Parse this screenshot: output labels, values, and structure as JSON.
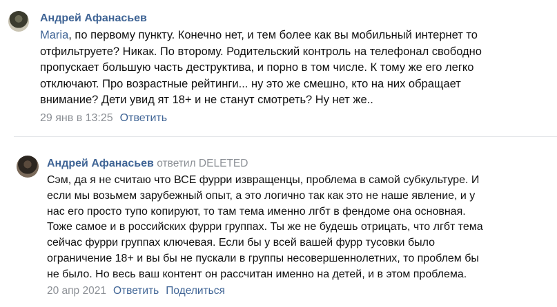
{
  "comments": [
    {
      "author": "Андрей Афанасьев",
      "mention": "Maria",
      "lines": [
        ", по первому пункту. Конечно нет, и тем более как вы мобильный интернет то",
        "отфильтруете? Никак. По второму. Родительский контроль на телефонал свободно",
        "пропускает большую часть деструктива, и порно в том числе. К тому же его легко",
        "отключают. Про возрастные рейтинги... ну это же смешно, кто на них обращает",
        "внимание? Дети увид ят 18+ и не станут смотреть? Ну нет же.."
      ],
      "date": "29 янв в 13:25",
      "reply_label": "Ответить"
    },
    {
      "author": "Андрей Афанасьев",
      "reply_to": "ответил DELETED",
      "lines": [
        "Сэм, да я не считаю что ВСЕ фурри извращенцы, проблема в самой субкультуре. И",
        "если мы возьмем зарубежный опыт, а это логично так как это не наше явление, и у",
        "нас его просто тупо копируют, то там тема именно лгбт в фендоме она основная.",
        "Тоже самое и в российских фурри группах. Ты же не будешь отрицать, что лгбт тема",
        "сейчас фурри группах ключевая. Если бы у всей вашей фурр тусовки было",
        "ограничение 18+ и вы бы не пускали в группы несовершеннолетних, то проблем бы",
        "не было. Но весь ваш контент он рассчитан именно на детей, и в этом проблема."
      ],
      "date": "20 апр 2021",
      "reply_label": "Ответить",
      "share_label": "Поделиться"
    }
  ]
}
